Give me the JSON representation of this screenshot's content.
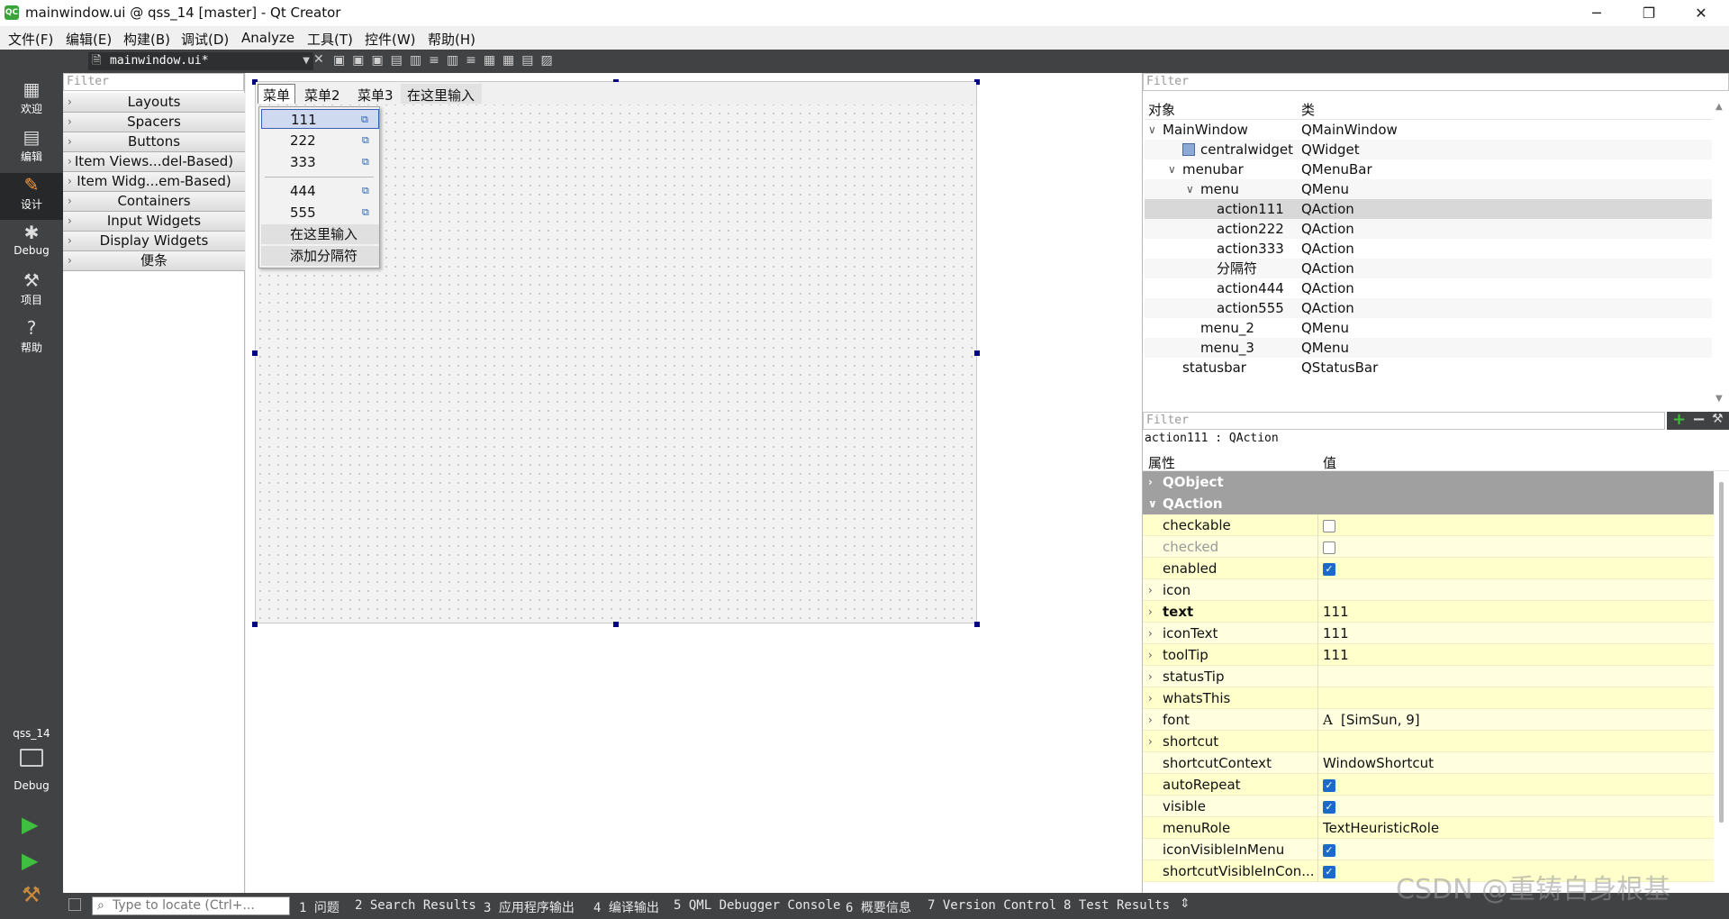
{
  "window": {
    "title": "mainwindow.ui @ qss_14 [master] - Qt Creator",
    "app_icon": "qt-creator-icon",
    "minimize": "─",
    "maximize": "❐",
    "close": "✕"
  },
  "menubar": [
    "文件(F)",
    "编辑(E)",
    "构建(B)",
    "调试(D)",
    "Analyze",
    "工具(T)",
    "控件(W)",
    "帮助(H)"
  ],
  "modes": [
    {
      "label": "欢迎",
      "icon": "welcome-grid-icon"
    },
    {
      "label": "编辑",
      "icon": "edit-document-icon"
    },
    {
      "label": "设计",
      "icon": "design-pencil-icon"
    },
    {
      "label": "Debug",
      "icon": "debug-bug-icon"
    },
    {
      "label": "项目",
      "icon": "project-wrench-icon"
    },
    {
      "label": "帮助",
      "icon": "help-question-icon"
    }
  ],
  "kit": {
    "project": "qss_14",
    "build": "Debug"
  },
  "editor_tab": {
    "file": "mainwindow.ui*"
  },
  "widget_box": {
    "filter_placeholder": "Filter",
    "categories": [
      "Layouts",
      "Spacers",
      "Buttons",
      "Item Views...del-Based)",
      "Item Widg...em-Based)",
      "Containers",
      "Input Widgets",
      "Display Widgets",
      "便条"
    ]
  },
  "form": {
    "menus": [
      "菜单",
      "菜单2",
      "菜单3",
      "在这里输入"
    ],
    "popup_items": [
      "111",
      "222",
      "333",
      "444",
      "555"
    ],
    "popup_type_here": "在这里输入",
    "popup_add_separator": "添加分隔符"
  },
  "object_inspector": {
    "filter_placeholder": "Filter",
    "col_object": "对象",
    "col_class": "类",
    "rows": [
      {
        "obj": "MainWindow",
        "cls": "QMainWindow"
      },
      {
        "obj": "centralwidget",
        "cls": "QWidget"
      },
      {
        "obj": "menubar",
        "cls": "QMenuBar"
      },
      {
        "obj": "menu",
        "cls": "QMenu"
      },
      {
        "obj": "action111",
        "cls": "QAction"
      },
      {
        "obj": "action222",
        "cls": "QAction"
      },
      {
        "obj": "action333",
        "cls": "QAction"
      },
      {
        "obj": "分隔符",
        "cls": "QAction"
      },
      {
        "obj": "action444",
        "cls": "QAction"
      },
      {
        "obj": "action555",
        "cls": "QAction"
      },
      {
        "obj": "menu_2",
        "cls": "QMenu"
      },
      {
        "obj": "menu_3",
        "cls": "QMenu"
      },
      {
        "obj": "statusbar",
        "cls": "QStatusBar"
      }
    ]
  },
  "property_editor": {
    "filter_placeholder": "Filter",
    "current": "action111 : QAction",
    "col_property": "属性",
    "col_value": "值",
    "groups": [
      "QObject",
      "QAction"
    ],
    "props": [
      {
        "name": "checkable",
        "value": ""
      },
      {
        "name": "checked",
        "value": ""
      },
      {
        "name": "enabled",
        "value": ""
      },
      {
        "name": "icon",
        "value": ""
      },
      {
        "name": "text",
        "value": "111"
      },
      {
        "name": "iconText",
        "value": "111"
      },
      {
        "name": "toolTip",
        "value": "111"
      },
      {
        "name": "statusTip",
        "value": ""
      },
      {
        "name": "whatsThis",
        "value": ""
      },
      {
        "name": "font",
        "value": "[SimSun, 9]"
      },
      {
        "name": "shortcut",
        "value": ""
      },
      {
        "name": "shortcutContext",
        "value": "WindowShortcut"
      },
      {
        "name": "autoRepeat",
        "value": ""
      },
      {
        "name": "visible",
        "value": ""
      },
      {
        "name": "menuRole",
        "value": "TextHeuristicRole"
      },
      {
        "name": "iconVisibleInMenu",
        "value": ""
      },
      {
        "name": "shortcutVisibleInCon...",
        "value": ""
      }
    ],
    "font_glyph": "A"
  },
  "output_bar": {
    "locator_placeholder": "Type to locate (Ctrl+...",
    "tabs": [
      "1 问题",
      "2 Search Results",
      "3 应用程序输出",
      "4 编译输出",
      "5 QML Debugger Console",
      "6 概要信息",
      "7 Version Control",
      "8 Test Results"
    ]
  },
  "watermark": "CSDN @重铸自身根基",
  "colors": {
    "sidebar": "#404244",
    "selection": "#d8d8d8",
    "prop_row": "#ffffcc",
    "group_header": "#a0a0a0",
    "check_on": "#1b6ac9"
  }
}
